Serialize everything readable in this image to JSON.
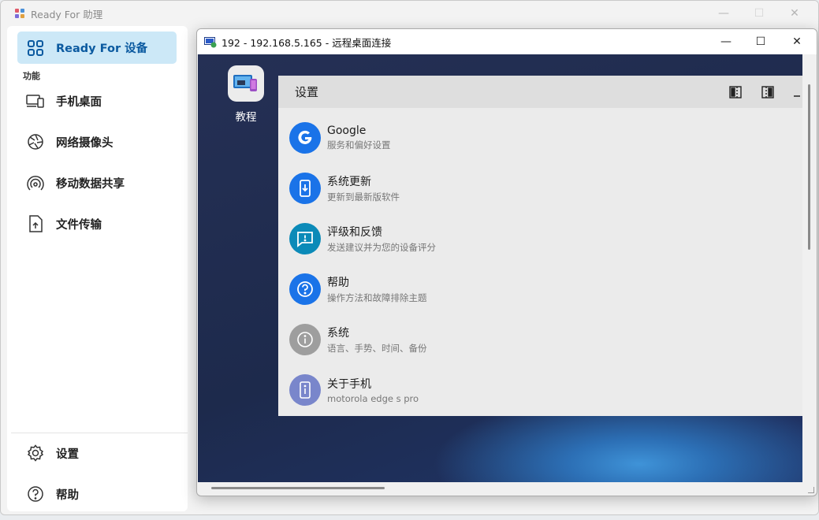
{
  "app": {
    "title": "Ready For 助理",
    "section_title": "功能",
    "nav_active": "Ready For 设备",
    "nav_items": [
      {
        "label": "手机桌面",
        "icon": "devices-icon"
      },
      {
        "label": "网络摄像头",
        "icon": "camera-aperture-icon"
      },
      {
        "label": "移动数据共享",
        "icon": "hotspot-icon"
      },
      {
        "label": "文件传输",
        "icon": "file-upload-icon"
      }
    ],
    "footer_items": [
      {
        "label": "设置",
        "icon": "gear-icon"
      },
      {
        "label": "帮助",
        "icon": "help-icon"
      }
    ],
    "window_controls": {
      "minimize": "—",
      "maximize": "☐",
      "close": "✕"
    }
  },
  "rdp": {
    "title": "192 - 192.168.5.165 - 远程桌面连接",
    "controls": {
      "minimize": "—",
      "maximize": "☐",
      "close": "✕"
    },
    "desktop_icon_label": "教程",
    "settings": {
      "title": "设置",
      "items": [
        {
          "title": "Google",
          "subtitle": "服务和偏好设置",
          "icon": "google-icon",
          "color": "#1a73e8"
        },
        {
          "title": "系统更新",
          "subtitle": "更新到最新版软件",
          "icon": "system-update-icon",
          "color": "#1a73e8"
        },
        {
          "title": "评级和反馈",
          "subtitle": "发送建议并为您的设备评分",
          "icon": "feedback-icon",
          "color": "#0b8ab8"
        },
        {
          "title": "帮助",
          "subtitle": "操作方法和故障排除主题",
          "icon": "help-circle-icon",
          "color": "#1a73e8"
        },
        {
          "title": "系统",
          "subtitle": "语言、手势、时间、备份",
          "icon": "info-icon",
          "color": "#9e9e9e"
        },
        {
          "title": "关于手机",
          "subtitle": "motorola edge s pro",
          "icon": "phone-info-icon",
          "color": "#7986cb"
        }
      ]
    }
  },
  "colors": {
    "accent": "#0b5aa0",
    "active_bg": "#cce8f7"
  }
}
